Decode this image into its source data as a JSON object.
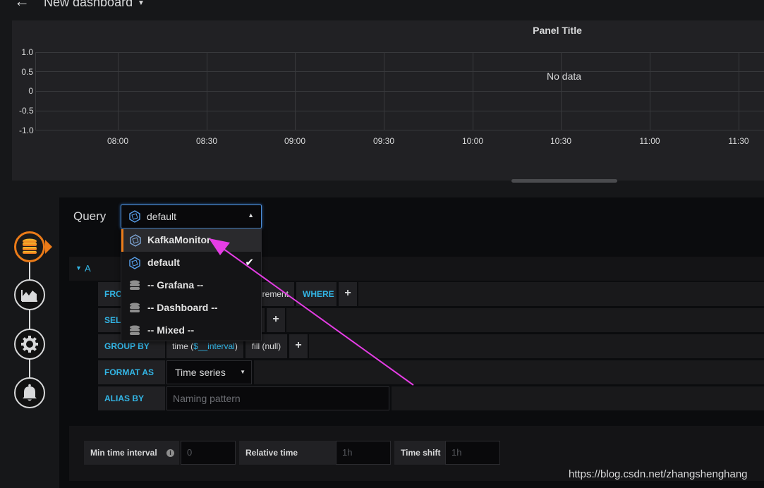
{
  "header": {
    "dashboard_title": "New dashboard"
  },
  "panel": {
    "title": "Panel Title",
    "no_data": "No data",
    "y_ticks": [
      "1.0",
      "0.5",
      "0",
      "-0.5",
      "-1.0"
    ],
    "x_ticks": [
      "08:00",
      "08:30",
      "09:00",
      "09:30",
      "10:00",
      "10:30",
      "11:00",
      "11:30"
    ]
  },
  "query": {
    "label": "Query",
    "datasource_selected": "default",
    "datasource_options": [
      {
        "label": "KafkaMonitor",
        "icon": "influxdb-icon",
        "highlighted": true
      },
      {
        "label": "default",
        "icon": "influxdb-icon",
        "checked": true
      },
      {
        "label": "-- Grafana --",
        "icon": "database-icon"
      },
      {
        "label": "-- Dashboard --",
        "icon": "database-icon"
      },
      {
        "label": "-- Mixed --",
        "icon": "database-icon"
      }
    ],
    "row_name": "A",
    "from_label": "FRO",
    "measurement_partial": "urement",
    "where_label": "WHERE",
    "select_label": "SELI",
    "group_by_label": "GROUP BY",
    "group_time_prefix": "time (",
    "group_time_var": "$__interval",
    "group_time_suffix": ")",
    "group_fill": "fill (null)",
    "format_as_label": "FORMAT AS",
    "format_as_value": "Time series",
    "alias_by_label": "ALIAS BY",
    "alias_placeholder": "Naming pattern",
    "plus": "+"
  },
  "options": {
    "min_interval_label": "Min time interval",
    "min_interval_placeholder": "0",
    "relative_time_label": "Relative time",
    "relative_time_placeholder": "1h",
    "time_shift_label": "Time shift",
    "time_shift_placeholder": "1h",
    "info_glyph": "i"
  },
  "watermark": "https://blog.csdn.net/zhangshenghang",
  "colors": {
    "accent_orange": "#eb7b18",
    "accent_blue": "#33b5e5",
    "arrow_magenta": "#e53de5"
  }
}
